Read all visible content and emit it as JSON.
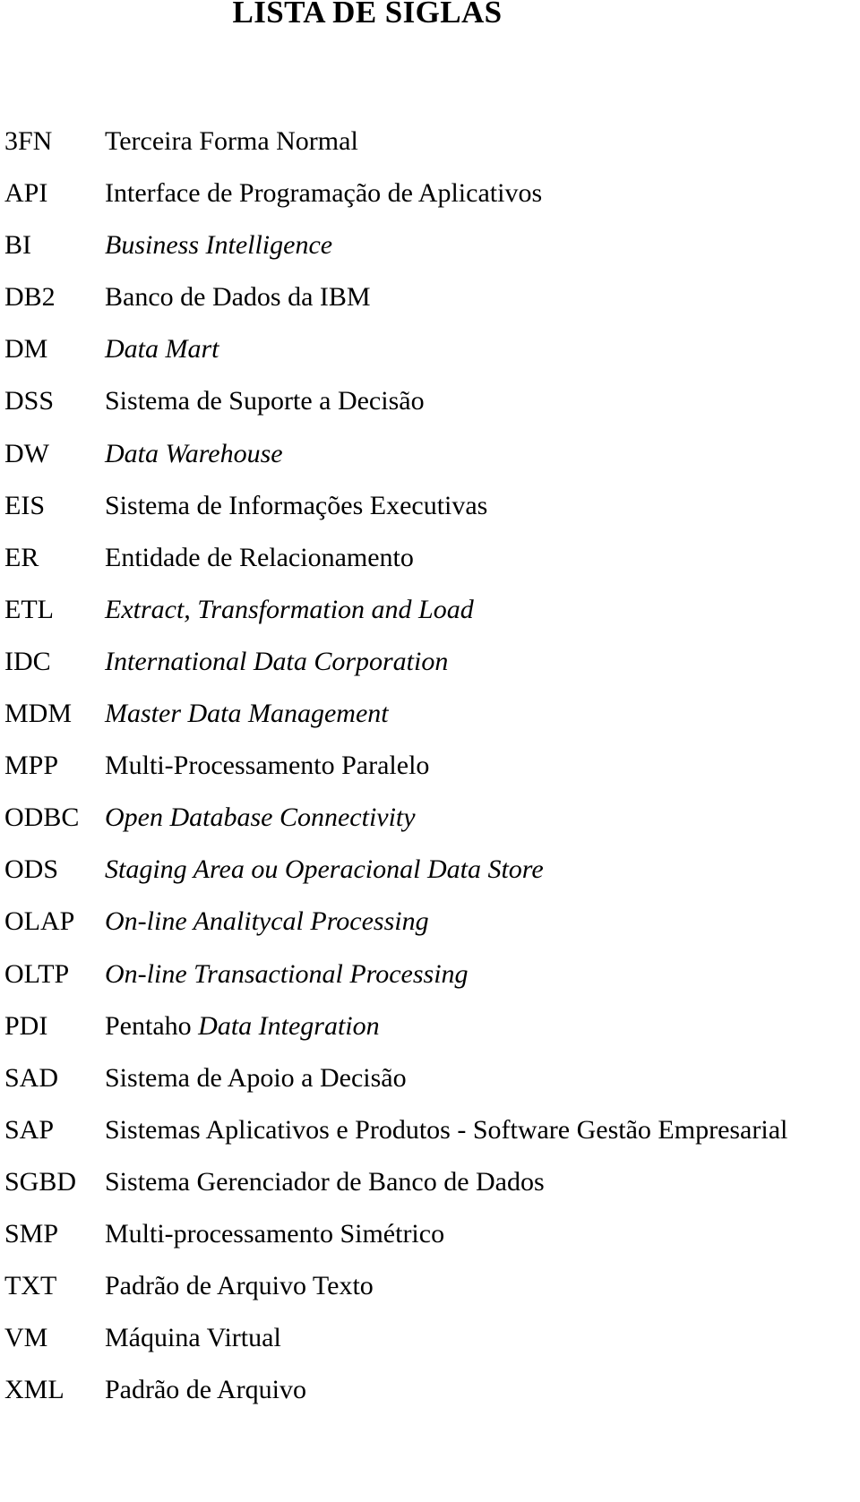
{
  "document": {
    "title": "LISTA DE SIGLAS",
    "entries": [
      {
        "term": "3FN",
        "definition": "Terceira Forma Normal",
        "style": "normal"
      },
      {
        "term": "API",
        "definition": "Interface de Programação de Aplicativos",
        "style": "normal"
      },
      {
        "term": "BI",
        "definition": "Business Intelligence",
        "style": "italic"
      },
      {
        "term": "DB2",
        "definition": "Banco de Dados da IBM",
        "style": "normal"
      },
      {
        "term": "DM",
        "definition": "Data Mart",
        "style": "italic"
      },
      {
        "term": "DSS",
        "definition": "Sistema de Suporte a Decisão",
        "style": "normal"
      },
      {
        "term": "DW",
        "definition": "Data Warehouse",
        "style": "italic"
      },
      {
        "term": "EIS",
        "definition": "Sistema de Informações Executivas",
        "style": "normal"
      },
      {
        "term": "ER",
        "definition": "Entidade de Relacionamento",
        "style": "normal"
      },
      {
        "term": "ETL",
        "definition": "Extract, Transformation and Load",
        "style": "italic"
      },
      {
        "term": "IDC",
        "definition": "International Data Corporation",
        "style": "italic"
      },
      {
        "term": "MDM",
        "definition": "Master Data Management",
        "style": "italic"
      },
      {
        "term": "MPP",
        "definition": "Multi-Processamento Paralelo",
        "style": "normal"
      },
      {
        "term": "ODBC",
        "definition": "Open Database Connectivity",
        "style": "italic"
      },
      {
        "term": "ODS",
        "definition": "Staging Area ou Operacional Data Store",
        "style": "italic"
      },
      {
        "term": "OLAP",
        "definition": "On-line Analitycal Processing",
        "style": "italic"
      },
      {
        "term": "OLTP",
        "definition": "On-line Transactional Processing",
        "style": "italic"
      },
      {
        "term": "PDI",
        "definition": "Pentaho Data Integration",
        "style": "mixed",
        "upright_prefix": "Pentaho ",
        "italic_suffix": "Data Integration"
      },
      {
        "term": "SAD",
        "definition": "Sistema de Apoio a Decisão",
        "style": "normal"
      },
      {
        "term": "SAP",
        "definition": "Sistemas Aplicativos e Produtos - Software Gestão Empresarial",
        "style": "normal"
      },
      {
        "term": "SGBD",
        "definition": "Sistema Gerenciador de Banco de Dados",
        "style": "normal"
      },
      {
        "term": "SMP",
        "definition": "Multi-processamento Simétrico",
        "style": "normal"
      },
      {
        "term": "TXT",
        "definition": "Padrão de Arquivo Texto",
        "style": "normal"
      },
      {
        "term": "VM",
        "definition": "Máquina Virtual",
        "style": "normal"
      },
      {
        "term": "XML",
        "definition": "Padrão de Arquivo",
        "style": "normal"
      }
    ]
  }
}
